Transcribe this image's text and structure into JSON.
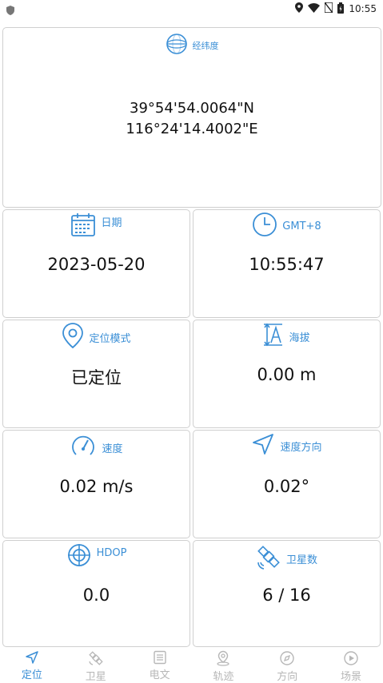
{
  "status_bar": {
    "time": "10:55"
  },
  "cards": {
    "coordinates": {
      "label": "经纬度",
      "lat": "39°54'54.0064\"N",
      "lon": "116°24'14.4002\"E"
    },
    "date": {
      "label": "日期",
      "value": "2023-05-20"
    },
    "timezone": {
      "label": "GMT+8",
      "value": "10:55:47"
    },
    "fix_mode": {
      "label": "定位模式",
      "value": "已定位"
    },
    "altitude": {
      "label": "海拔",
      "value": "0.00 m"
    },
    "speed": {
      "label": "速度",
      "value": "0.02 m/s"
    },
    "heading": {
      "label": "速度方向",
      "value": "0.02°"
    },
    "hdop": {
      "label": "HDOP",
      "value": "0.0"
    },
    "satellites": {
      "label": "卫星数",
      "value": "6 / 16"
    }
  },
  "tabs": [
    {
      "label": "定位",
      "icon": "navigation-arrow-icon",
      "active": true
    },
    {
      "label": "卫星",
      "icon": "satellite-icon",
      "active": false
    },
    {
      "label": "电文",
      "icon": "document-icon",
      "active": false
    },
    {
      "label": "轨迹",
      "icon": "map-pin-icon",
      "active": false
    },
    {
      "label": "方向",
      "icon": "compass-icon",
      "active": false
    },
    {
      "label": "场景",
      "icon": "play-icon",
      "active": false
    }
  ],
  "colors": {
    "accent": "#3b8fd6",
    "inactive": "#b7b7b7",
    "card_border": "#cfcfcf"
  }
}
